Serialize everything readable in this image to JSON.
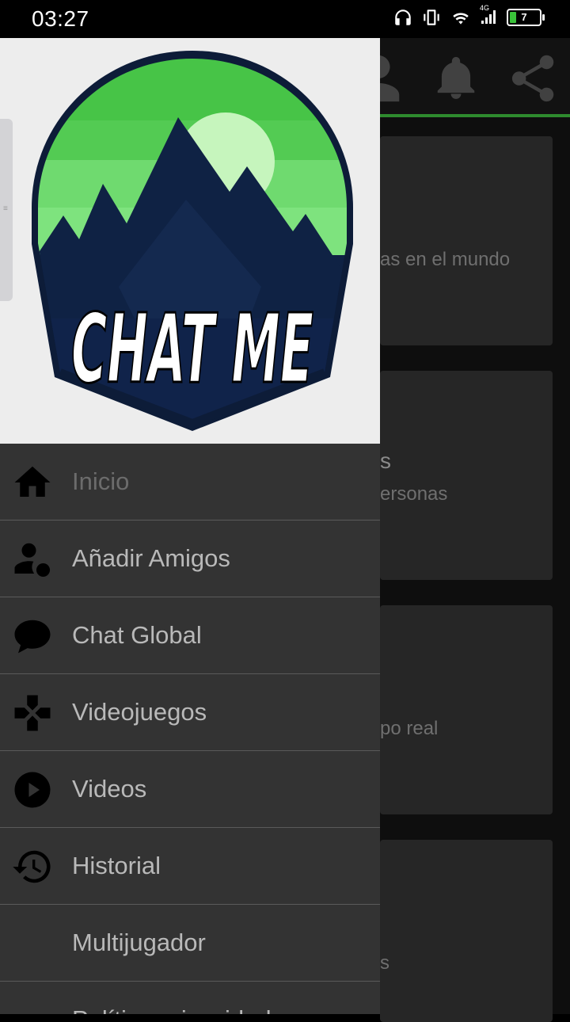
{
  "status_bar": {
    "time": "03:27",
    "network_label": "4G",
    "battery_level": "7",
    "icons": [
      "headphones-icon",
      "vibrate-icon",
      "wifi-icon",
      "signal-icon",
      "battery-icon"
    ]
  },
  "app_toolbar": {
    "icons": [
      "person-icon",
      "bell-icon",
      "share-icon"
    ],
    "accent_color": "#2e8b2e"
  },
  "background_cards": [
    {
      "title": "",
      "subtitle": "as en el mundo"
    },
    {
      "title": "s",
      "subtitle": "ersonas"
    },
    {
      "title": "",
      "subtitle": "po real"
    },
    {
      "title": "",
      "subtitle": "s"
    }
  ],
  "drawer": {
    "logo": {
      "text": "CHAT ME",
      "colors": {
        "sky": "#5fd45f",
        "sun": "#c6f5bd",
        "mountain": "#0f2244",
        "border": "#0d1c38"
      }
    },
    "menu": [
      {
        "label": "Inicio",
        "icon": "home-icon",
        "active": true
      },
      {
        "label": "Añadir Amigos",
        "icon": "add-person-icon",
        "active": false
      },
      {
        "label": "Chat Global",
        "icon": "chat-bubble-icon",
        "active": false
      },
      {
        "label": "Videojuegos",
        "icon": "gamepad-icon",
        "active": false
      },
      {
        "label": "Videos",
        "icon": "play-circle-icon",
        "active": false
      },
      {
        "label": "Historial",
        "icon": "history-icon",
        "active": false
      },
      {
        "label": "Multijugador",
        "icon": "",
        "active": false
      },
      {
        "label": "Política privacidad",
        "icon": "",
        "active": false
      }
    ]
  }
}
